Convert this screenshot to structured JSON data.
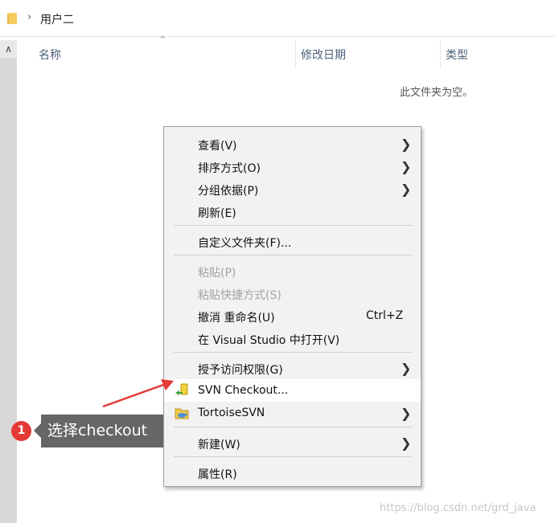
{
  "address_bar": {
    "breadcrumb": "用户二"
  },
  "columns": {
    "name": "名称",
    "modified": "修改日期",
    "type": "类型"
  },
  "folder_empty_text": "此文件夹为空。",
  "context_menu": {
    "items": [
      {
        "label": "查看(V)"
      },
      {
        "label": "排序方式(O)"
      },
      {
        "label": "分组依据(P)"
      },
      {
        "label": "刷新(E)"
      },
      {
        "label": "自定义文件夹(F)..."
      },
      {
        "label": "粘贴(P)"
      },
      {
        "label": "粘贴快捷方式(S)"
      },
      {
        "label": "撤消 重命名(U)",
        "shortcut": "Ctrl+Z"
      },
      {
        "label": "在 Visual Studio 中打开(V)"
      },
      {
        "label": "授予访问权限(G)"
      },
      {
        "label": "SVN Checkout..."
      },
      {
        "label": "TortoiseSVN"
      },
      {
        "label": "新建(W)"
      },
      {
        "label": "属性(R)"
      }
    ]
  },
  "annotation": {
    "step_number": "1",
    "text": "选择checkout"
  },
  "watermark": "https://blog.csdn.net/grd_java",
  "colors": {
    "menu_bg": "#f2f2f2",
    "highlight_bg": "#ffffff",
    "badge": "#e53935",
    "callout": "#666666",
    "arrow": "#e53935"
  }
}
